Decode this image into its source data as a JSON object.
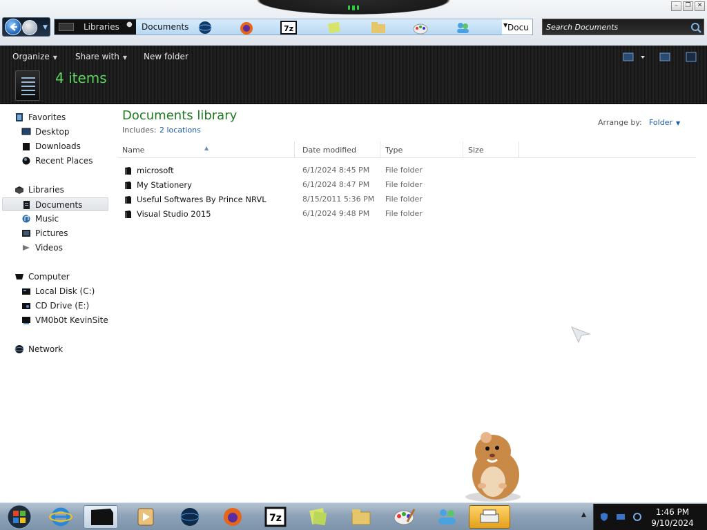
{
  "window": {
    "breadcrumbs": [
      "Libraries",
      "Documents"
    ],
    "address_field_text": "Docu",
    "search_placeholder": "Search Documents"
  },
  "toolbar": {
    "organize": "Organize",
    "share_with": "Share with",
    "new_folder": "New folder"
  },
  "header": {
    "item_count": "4 items"
  },
  "nav": {
    "favorites": {
      "title": "Favorites",
      "items": [
        "Desktop",
        "Downloads",
        "Recent Places"
      ]
    },
    "libraries": {
      "title": "Libraries",
      "items": [
        "Documents",
        "Music",
        "Pictures",
        "Videos"
      ],
      "selected": "Documents"
    },
    "computer": {
      "title": "Computer",
      "items": [
        "Local Disk (C:)",
        "CD Drive (E:)",
        "VM0b0t KevinSite"
      ]
    },
    "network": {
      "title": "Network"
    }
  },
  "library": {
    "title": "Documents library",
    "includes_label": "Includes:",
    "locations_link": "2 locations",
    "arrange_label": "Arrange by:",
    "arrange_value": "Folder"
  },
  "columns": {
    "name": "Name",
    "date": "Date modified",
    "type": "Type",
    "size": "Size"
  },
  "files": [
    {
      "name": "microsoft",
      "date": "6/1/2024 8:45 PM",
      "type": "File folder"
    },
    {
      "name": "My Stationery",
      "date": "6/1/2024 8:47 PM",
      "type": "File folder"
    },
    {
      "name": "Useful Softwares By Prince NRVL",
      "date": "8/15/2011 5:36 PM",
      "type": "File folder"
    },
    {
      "name": "Visual Studio 2015",
      "date": "6/1/2024 9:48 PM",
      "type": "File folder"
    }
  ],
  "taskbar": {
    "time": "1:46 PM",
    "date": "9/10/2024"
  },
  "colors": {
    "accent_green": "#1e7b1e",
    "item_count_green": "#5dd660",
    "link_blue": "#1c5aa8"
  }
}
